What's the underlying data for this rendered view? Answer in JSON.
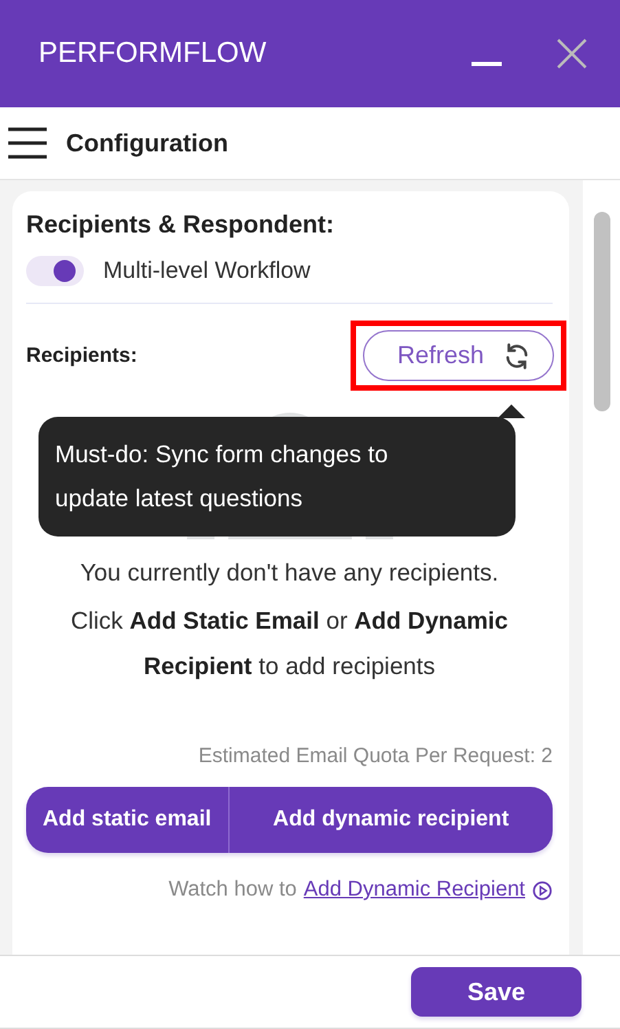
{
  "header": {
    "title": "PERFORMFLOW"
  },
  "toolbar": {
    "title": "Configuration"
  },
  "section": {
    "title": "Recipients & Respondent:",
    "toggle": {
      "label": "Multi-level Workflow",
      "on": true
    }
  },
  "recipients": {
    "label": "Recipients:",
    "refresh_button": "Refresh",
    "highlighted": true,
    "tooltip": "Must-do: Sync form changes to update latest questions",
    "empty_message": "You currently don't have any recipients.",
    "instruction": "Click **Add Static Email** or **Add Dynamic Recipient** to add recipients",
    "quota": "Estimated Email Quota Per Request: 2",
    "buttons": [
      "Add static email",
      "Add dynamic recipient"
    ],
    "watch_prefix": "Watch how to",
    "watch_link": "Add Dynamic Recipient"
  },
  "footer": {
    "save_button": "Save"
  }
}
